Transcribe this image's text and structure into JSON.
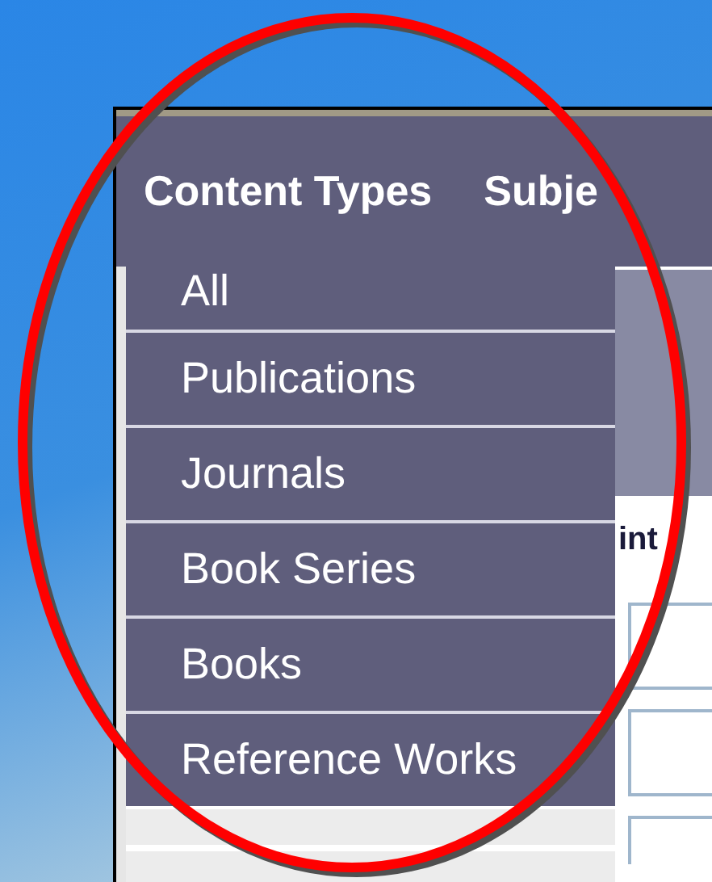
{
  "nav": [
    {
      "label": "Content Types"
    },
    {
      "label": "Subje"
    }
  ],
  "menu": [
    {
      "label": "All"
    },
    {
      "label": "Publications"
    },
    {
      "label": "Journals"
    },
    {
      "label": "Book Series"
    },
    {
      "label": "Books"
    },
    {
      "label": "Reference Works"
    }
  ],
  "side_heading": "int"
}
